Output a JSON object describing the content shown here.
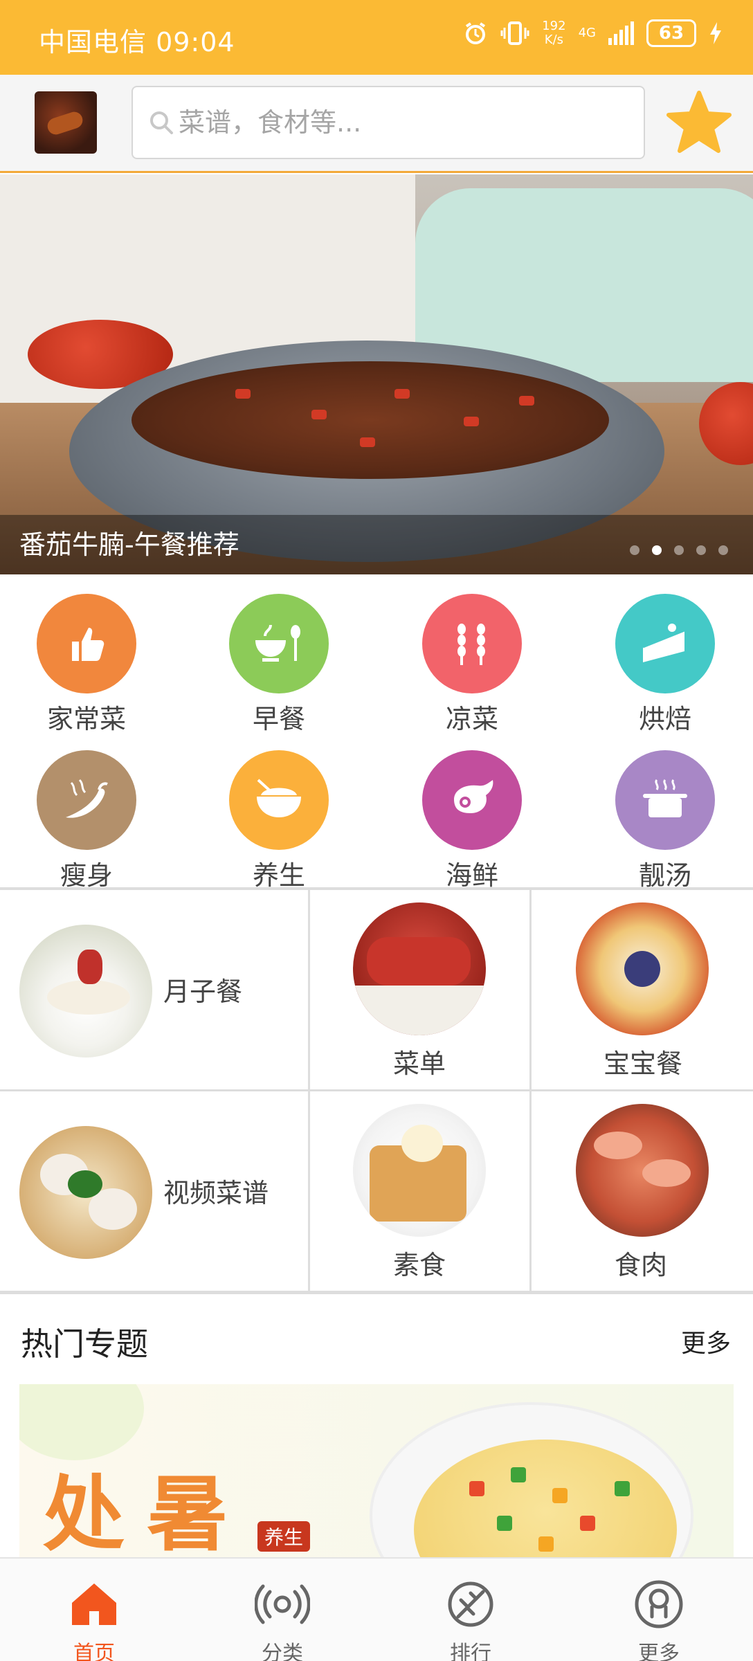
{
  "status_bar": {
    "carrier_time": "中国电信 09:04",
    "speed_value": "192",
    "speed_unit": "K/s",
    "network": "4G",
    "battery": "63"
  },
  "header": {
    "search_placeholder": "菜谱，食材等...",
    "favorite_icon": "star-icon"
  },
  "banner": {
    "caption": "番茄牛腩-午餐推荐",
    "slide_count": 5,
    "active_slide": 2
  },
  "categories": [
    {
      "label": "家常菜",
      "icon": "thumbs-up-icon",
      "color": "#F1873D"
    },
    {
      "label": "早餐",
      "icon": "bowl-spoon-icon",
      "color": "#8CCB58"
    },
    {
      "label": "凉菜",
      "icon": "wheat-icon",
      "color": "#F2636A"
    },
    {
      "label": "烘焙",
      "icon": "cake-icon",
      "color": "#44C9C7"
    },
    {
      "label": "瘦身",
      "icon": "pepper-icon",
      "color": "#B3906B"
    },
    {
      "label": "养生",
      "icon": "rice-bowl-icon",
      "color": "#FBB03B"
    },
    {
      "label": "海鲜",
      "icon": "ham-icon",
      "color": "#C24E9D"
    },
    {
      "label": "靓汤",
      "icon": "soup-pot-icon",
      "color": "#A887C6"
    }
  ],
  "features": {
    "confinement": "月子餐",
    "menu": "菜单",
    "baby": "宝宝餐",
    "video": "视频菜谱",
    "vegetarian": "素食",
    "meat": "食肉"
  },
  "hot": {
    "title": "热门专题",
    "more": "更多",
    "promo_title": "处暑",
    "promo_tag": "养生"
  },
  "nav": [
    {
      "label": "首页",
      "icon": "home-icon",
      "active": true
    },
    {
      "label": "分类",
      "icon": "broadcast-icon",
      "active": false
    },
    {
      "label": "排行",
      "icon": "ranking-icon",
      "active": false
    },
    {
      "label": "更多",
      "icon": "more-icon",
      "active": false
    }
  ],
  "colors": {
    "status_bar": "#FBBA34",
    "accent": "#F2561E",
    "star": "#FBBA34"
  }
}
